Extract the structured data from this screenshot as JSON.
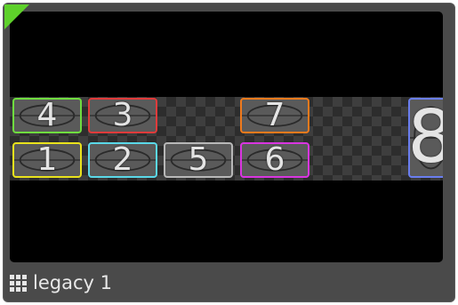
{
  "card": {
    "label": "legacy 1",
    "icon": "grid-icon",
    "status_color": "#5ed12a",
    "status_icon": "green-corner-indicator"
  },
  "screens": [
    {
      "number": "4",
      "color": "#6fdc3f"
    },
    {
      "number": "3",
      "color": "#e03b3b"
    },
    {
      "number": "7",
      "color": "#f07a1c"
    },
    {
      "number": "8",
      "color": "#6a7ef0"
    },
    {
      "number": "1",
      "color": "#e9e21c"
    },
    {
      "number": "2",
      "color": "#5ad8e8"
    },
    {
      "number": "5",
      "color": "#b8b8b8"
    },
    {
      "number": "6",
      "color": "#d935e0"
    }
  ]
}
